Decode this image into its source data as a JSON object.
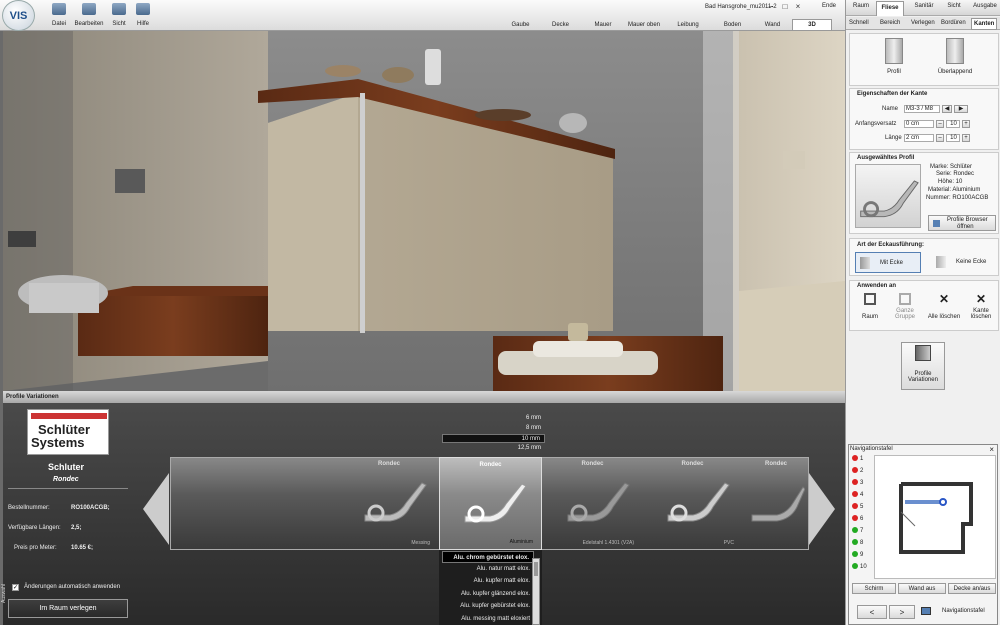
{
  "app": {
    "logo_text": "VIS",
    "window_title": "Bad Hansgrohe_mu2011-2"
  },
  "toolbar": {
    "menus": [
      {
        "label": "Datei"
      },
      {
        "label": "Bearbeiten"
      },
      {
        "label": "Sicht"
      },
      {
        "label": "Hilfe"
      }
    ],
    "right_labels": {
      "ende": "Ende",
      "raum": "Raum",
      "fliese": "Fliese",
      "sanitaer": "Sanitär",
      "sicht": "Sicht",
      "ausgabe": "Ausgabe"
    },
    "view_tabs": [
      "Gaube",
      "Decke",
      "Mauer",
      "Mauer oben",
      "Leibung",
      "Boden",
      "Wand"
    ],
    "view_3d": "3D"
  },
  "right_panel": {
    "subtabs": [
      "Schnell",
      "Bereich",
      "Verlegen",
      "Bordüren",
      "Kanten"
    ],
    "profile_icons": {
      "profil": "Profil",
      "ueberlappend": "Überlappend"
    },
    "eigenschaften": {
      "title": "Eigenschaften der Kante",
      "name_label": "Name",
      "name_value": "M3-3 / M8",
      "anfang_label": "Anfangsversatz",
      "anfang_value": "0 cm",
      "anfang_step": "10",
      "laenge_label": "Länge",
      "laenge_value": "2 cm",
      "laenge_step": "10"
    },
    "ausgewaehlt": {
      "title": "Ausgewähltes Profil",
      "details": [
        "Marke: Schlüter",
        "Serie: Rondec",
        "Höhe: 10",
        "Material: Aluminium",
        "Nummer: RO100ACGB"
      ],
      "browser_btn_1": "Profile Browser",
      "browser_btn_2": "öffnen"
    },
    "eckausfuehrung": {
      "title": "Art der Eckausführung:",
      "mit": "Mit Ecke",
      "keine": "Keine Ecke"
    },
    "anwenden": {
      "title": "Anwenden an",
      "raum": "Raum",
      "ganze_1": "Ganze",
      "ganze_2": "Gruppe",
      "alle": "Alle löschen",
      "kante_1": "Kante",
      "kante_2": "löschen"
    },
    "variationen": {
      "line1": "Profile",
      "line2": "Variationen"
    }
  },
  "nav": {
    "title": "Navigationstafel",
    "rows": [
      "1",
      "2",
      "3",
      "4",
      "5",
      "6",
      "7",
      "8",
      "9",
      "10"
    ],
    "buttons": {
      "schirm": "Schirm",
      "wand_aus": "Wand aus",
      "decke_an_aus": "Decke an/aus"
    },
    "footer_label": "Navigationstafel"
  },
  "variations": {
    "header": "Profile Variationen",
    "brand_line1": "Schlüter",
    "brand_line2": "Systems",
    "maker": "Schluter",
    "series": "Rondec",
    "bestell_label": "Bestellnummer:",
    "bestell_value": "RO100ACGB;",
    "laengen_label": "Verfügbare Längen:",
    "laengen_value": "2,5;",
    "preis_label": "Preis pro Meter:",
    "preis_value": "10.65 €;",
    "auto_label": "Änderungen automatisch anwenden",
    "place_btn": "Im Raum verlegen",
    "side_tab": "Auswahl",
    "sizes": [
      "6 mm",
      "8 mm",
      "10 mm",
      "12,5 mm"
    ],
    "cards": [
      {
        "name": "Rondec",
        "material": "Messing"
      },
      {
        "name": "Rondec",
        "material": "Aluminium"
      },
      {
        "name": "Rondec",
        "material": "Edelstahl 1.4301 (V2A)"
      },
      {
        "name": "Rondec",
        "material": "PVC"
      },
      {
        "name": "Rondec",
        "material": ""
      }
    ],
    "finishes": [
      "Alu. chrom gebürstet elox.",
      "Alu. natur matt elox.",
      "Alu. kupfer matt elox.",
      "Alu. kupfer glänzend elox.",
      "Alu. kupfer gebürstet elox.",
      "Alu. messing matt eloxiert"
    ]
  },
  "colors": {
    "accent": "#2a56c6",
    "dark_panel": "#2e2e2e"
  }
}
